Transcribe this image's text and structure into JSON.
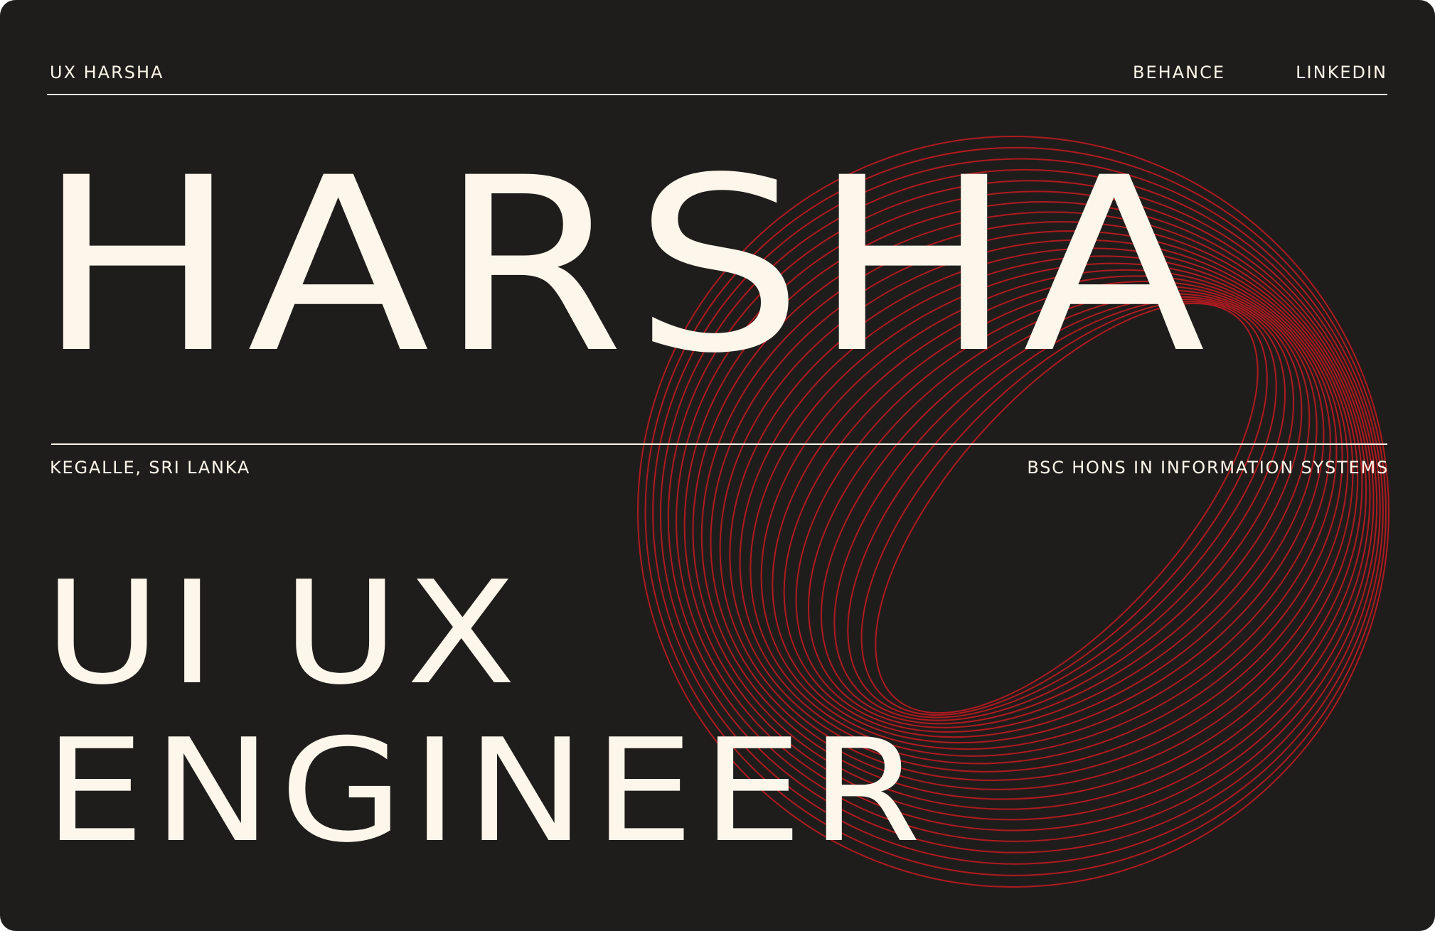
{
  "header": {
    "brand": "UX HARSHA",
    "links": [
      {
        "label": "BEHANCE"
      },
      {
        "label": "LINKEDIN"
      }
    ]
  },
  "hero": {
    "name": "HARSHA"
  },
  "meta": {
    "location": "KEGALLE, SRI LANKA",
    "degree": "BSC HONS IN INFORMATION SYSTEMS"
  },
  "role": {
    "line1": "UI UX",
    "line2": "ENGINEER"
  },
  "colors": {
    "background": "#1f1d1c",
    "text": "#fdf6ea",
    "accent": "#b01a1f"
  }
}
